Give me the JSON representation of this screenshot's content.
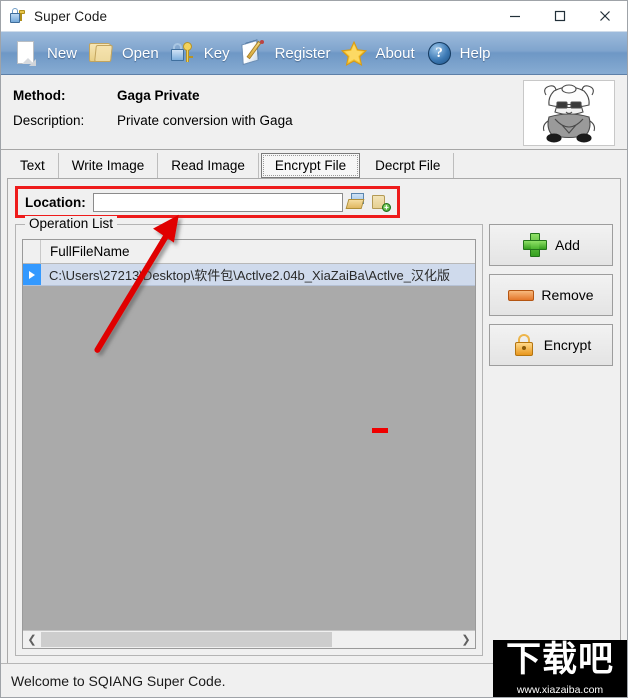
{
  "window": {
    "title": "Super Code",
    "app_icon": "lock-key-icon",
    "controls": {
      "minimize": "minimize-icon",
      "maximize": "maximize-icon",
      "close": "close-icon"
    }
  },
  "toolbar": {
    "items": [
      {
        "label": "New",
        "icon": "new-document-icon"
      },
      {
        "label": "Open",
        "icon": "open-folder-icon"
      },
      {
        "label": "Key",
        "icon": "lock-key-icon"
      },
      {
        "label": "Register",
        "icon": "register-pencil-icon"
      },
      {
        "label": "About",
        "icon": "star-icon"
      },
      {
        "label": "Help",
        "icon": "question-mark-icon"
      }
    ]
  },
  "method_panel": {
    "method_label": "Method:",
    "method_value": "Gaga Private",
    "description_label": "Description:",
    "description_value": "Private conversion with Gaga",
    "avatar_icon": "anime-girl-avatar"
  },
  "tabs": [
    {
      "label": "Text",
      "selected": false
    },
    {
      "label": "Write Image",
      "selected": false
    },
    {
      "label": "Read Image",
      "selected": false
    },
    {
      "label": "Encrypt File",
      "selected": true
    },
    {
      "label": "Decrpt File",
      "selected": false
    }
  ],
  "location": {
    "label": "Location:",
    "value": "",
    "placeholder": "",
    "browse_icon": "open-folder-icon",
    "new_folder_icon": "new-folder-icon"
  },
  "operation_list": {
    "legend": "Operation List",
    "columns": [
      "",
      "FullFileName"
    ],
    "rows": [
      {
        "indicator": "row-selected-arrow-icon",
        "full_file_name": "C:\\Users\\27213\\Desktop\\软件包\\Actlve2.04b_XiaZaiBa\\Actlve_汉化版"
      }
    ],
    "hscroll": {
      "left_arrow": "chevron-left-icon",
      "right_arrow": "chevron-right-icon"
    }
  },
  "side_buttons": [
    {
      "label": "Add",
      "icon": "green-plus-icon"
    },
    {
      "label": "Remove",
      "icon": "orange-bar-icon"
    },
    {
      "label": "Encrypt",
      "icon": "padlock-icon"
    }
  ],
  "status_bar": {
    "text": "Welcome to SQIANG Super Code."
  },
  "watermark": {
    "logo_text": "下载吧",
    "url": "www.xiazaiba.com"
  },
  "annotations": {
    "location_highlight_color": "#ee1b1b",
    "arrow_color": "#e00000",
    "dash_color": "#f00000"
  }
}
